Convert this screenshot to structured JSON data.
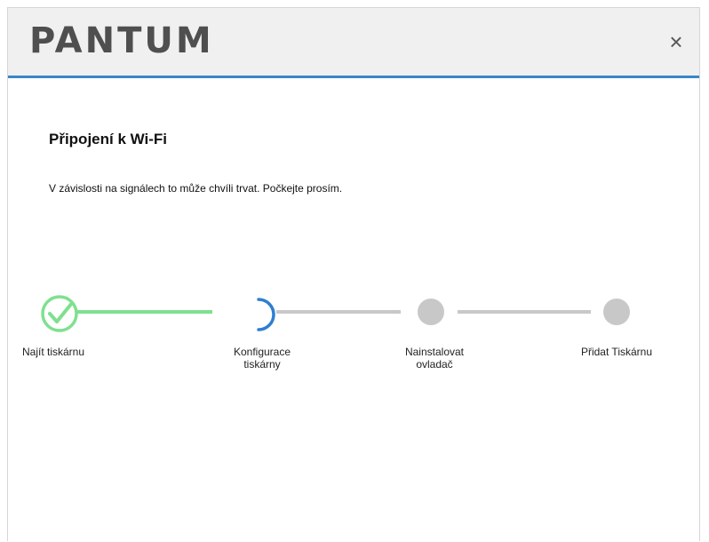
{
  "header": {
    "logo": "PANTUM",
    "close_symbol": "×"
  },
  "content": {
    "title": "Připojení k Wi-Fi",
    "subtitle": "V závislosti na signálech to může chvíli trvat. Počkejte prosím."
  },
  "steps": [
    {
      "label_line1": "Najít tiskárnu",
      "label_line2": "",
      "status": "done"
    },
    {
      "label_line1": "Konfigurace",
      "label_line2": "tiskárny",
      "status": "in-progress"
    },
    {
      "label_line1": "Nainstalovat",
      "label_line2": "ovladač",
      "status": "pending"
    },
    {
      "label_line1": "Přidat Tiskárnu",
      "label_line2": "",
      "status": "pending"
    }
  ],
  "colors": {
    "accent": "#3a86c8",
    "done": "#7fe08f",
    "pending": "#c8c8c8",
    "spinner": "#2f7fd0"
  }
}
